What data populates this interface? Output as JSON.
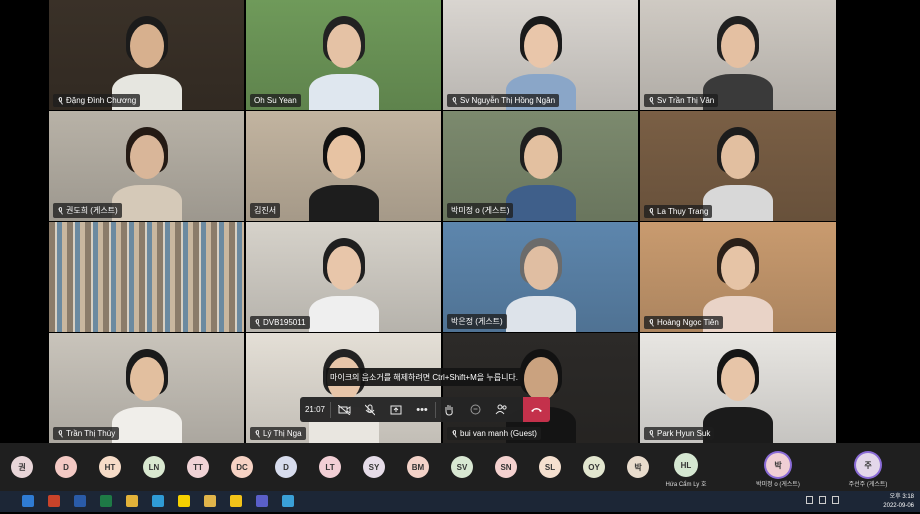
{
  "participants": [
    {
      "name": "Đặng Đình Chương",
      "muted": true,
      "bg": "#3a3128",
      "skin": "#d7b08e",
      "hair": "#1b1b1b",
      "shirt": "#e6e6e0"
    },
    {
      "name": "Oh Su Yean",
      "muted": false,
      "bg": "#6f9a5a",
      "skin": "#e5c2a5",
      "hair": "#222",
      "shirt": "#dfe7ef"
    },
    {
      "name": "Sv Nguyễn Thị Hồng Ngân",
      "muted": true,
      "bg": "#d9d5d0",
      "skin": "#e9c6aa",
      "hair": "#1a1a1a",
      "shirt": "#8aa6c8"
    },
    {
      "name": "Sv Trần Thị Vân",
      "muted": true,
      "bg": "#cfcac3",
      "skin": "#e4c0a2",
      "hair": "#202020",
      "shirt": "#3a3a3a"
    },
    {
      "name": "권도희 (게스트)",
      "muted": true,
      "bg": "#b8b2a7",
      "skin": "#d9b699",
      "hair": "#241a14",
      "shirt": "#d5c9b8"
    },
    {
      "name": "김진서",
      "muted": false,
      "bg": "#c2b4a0",
      "skin": "#e7c3a3",
      "hair": "#111",
      "shirt": "#1d1d1d"
    },
    {
      "name": "박미정 o (게스트)",
      "muted": false,
      "bg": "#7c8a6e",
      "skin": "#e3c0a0",
      "hair": "#1e1e1e",
      "shirt": "#3f5f8a"
    },
    {
      "name": "La Thụy Trang",
      "muted": true,
      "bg": "#7a5f45",
      "skin": "#e2bfa0",
      "hair": "#1c1c1c",
      "shirt": "#d8d8d8"
    },
    {
      "name": "Trần Thị Thúy",
      "muted": true,
      "bg": "#c9c4bb",
      "skin": "#e2bf9f",
      "hair": "#1a1a1a",
      "shirt": "#f0eeea"
    },
    {
      "name": "DVB195011",
      "muted": true,
      "bg": "#d6d2ca",
      "skin": "#e8c6aa",
      "hair": "#1f1f1f",
      "shirt": "#efefef"
    },
    {
      "name": "박은정 (게스트)",
      "muted": false,
      "bg": "#5d86ad",
      "skin": "#e0bea2",
      "hair": "#6b6b6b",
      "shirt": "#dde3ea"
    },
    {
      "name": "Hoàng Ngọc Tiên",
      "muted": true,
      "bg": "#c99b6f",
      "skin": "#e6c4a6",
      "hair": "#2a2019",
      "shirt": "#e9d3c7"
    },
    {
      "name": "Lý Thị Nga",
      "muted": true,
      "bg": "#e4dfd6",
      "skin": "#e7c5a8",
      "hair": "#222",
      "shirt": "#e9e6e0"
    },
    {
      "name": "bui van manh (Guest)",
      "muted": true,
      "bg": "#2c2a28",
      "skin": "#caa27f",
      "hair": "#121212",
      "shirt": "#141414"
    },
    {
      "name": "Park Hyun Suk",
      "muted": true,
      "bg": "#e8e6e2",
      "skin": "#e7c5a8",
      "hair": "#151515",
      "shirt": "#1b1b1b"
    }
  ],
  "toast": "마이크의 음소거를 해제하려면 Ctrl+Shift+M을 누릅니다.",
  "controls": {
    "timer": "21:07"
  },
  "roster": [
    {
      "initials": "권",
      "color": "#e8d5d8"
    },
    {
      "initials": "D",
      "color": "#f3c9c4"
    },
    {
      "initials": "HT",
      "color": "#f6dcc8"
    },
    {
      "initials": "LN",
      "color": "#d9e8d0"
    },
    {
      "initials": "TT",
      "color": "#f0d3d6"
    },
    {
      "initials": "DC",
      "color": "#f6d2c4"
    },
    {
      "initials": "D",
      "color": "#d7dced"
    },
    {
      "initials": "LT",
      "color": "#f2cfd5"
    },
    {
      "initials": "SY",
      "color": "#e6dce8"
    },
    {
      "initials": "BM",
      "color": "#f3d2c8"
    },
    {
      "initials": "SV",
      "color": "#d8e7d2"
    },
    {
      "initials": "SN",
      "color": "#f4d1cf"
    },
    {
      "initials": "SL",
      "color": "#f5e0cf"
    },
    {
      "initials": "OY",
      "color": "#e2e6cf"
    },
    {
      "initials": "박",
      "color": "#e9dccd"
    }
  ],
  "roster_right": [
    {
      "initials": "HL",
      "label": "Hứa Cẩm Ly 호",
      "color": "#d5e7d1"
    },
    {
      "initials": "박",
      "label": "박미정 o (게스트)",
      "color": "#f0cfd4"
    },
    {
      "initials": "주",
      "label": "주선주 (게스트)",
      "color": "#e3d7ea"
    }
  ],
  "taskbar": {
    "apps": [
      {
        "icon": "edge-legacy-icon",
        "color": "#2f7bd3"
      },
      {
        "icon": "powerpoint-icon",
        "color": "#c9432a"
      },
      {
        "icon": "word-icon",
        "color": "#2a5ba8"
      },
      {
        "icon": "excel-icon",
        "color": "#1e7a46"
      },
      {
        "icon": "chrome-icon",
        "color": "#e2b23a"
      },
      {
        "icon": "edge-icon",
        "color": "#2f9bd6"
      },
      {
        "icon": "kakaotalk-icon",
        "color": "#f5d000"
      },
      {
        "icon": "folder-icon",
        "color": "#e0b44a"
      },
      {
        "icon": "sticky-notes-icon",
        "color": "#f2c319"
      },
      {
        "icon": "teams-icon",
        "color": "#5a5fc9"
      },
      {
        "icon": "app-icon",
        "color": "#3aa0d8"
      }
    ],
    "time": "오후 3:18",
    "date": "2022-09-06"
  }
}
